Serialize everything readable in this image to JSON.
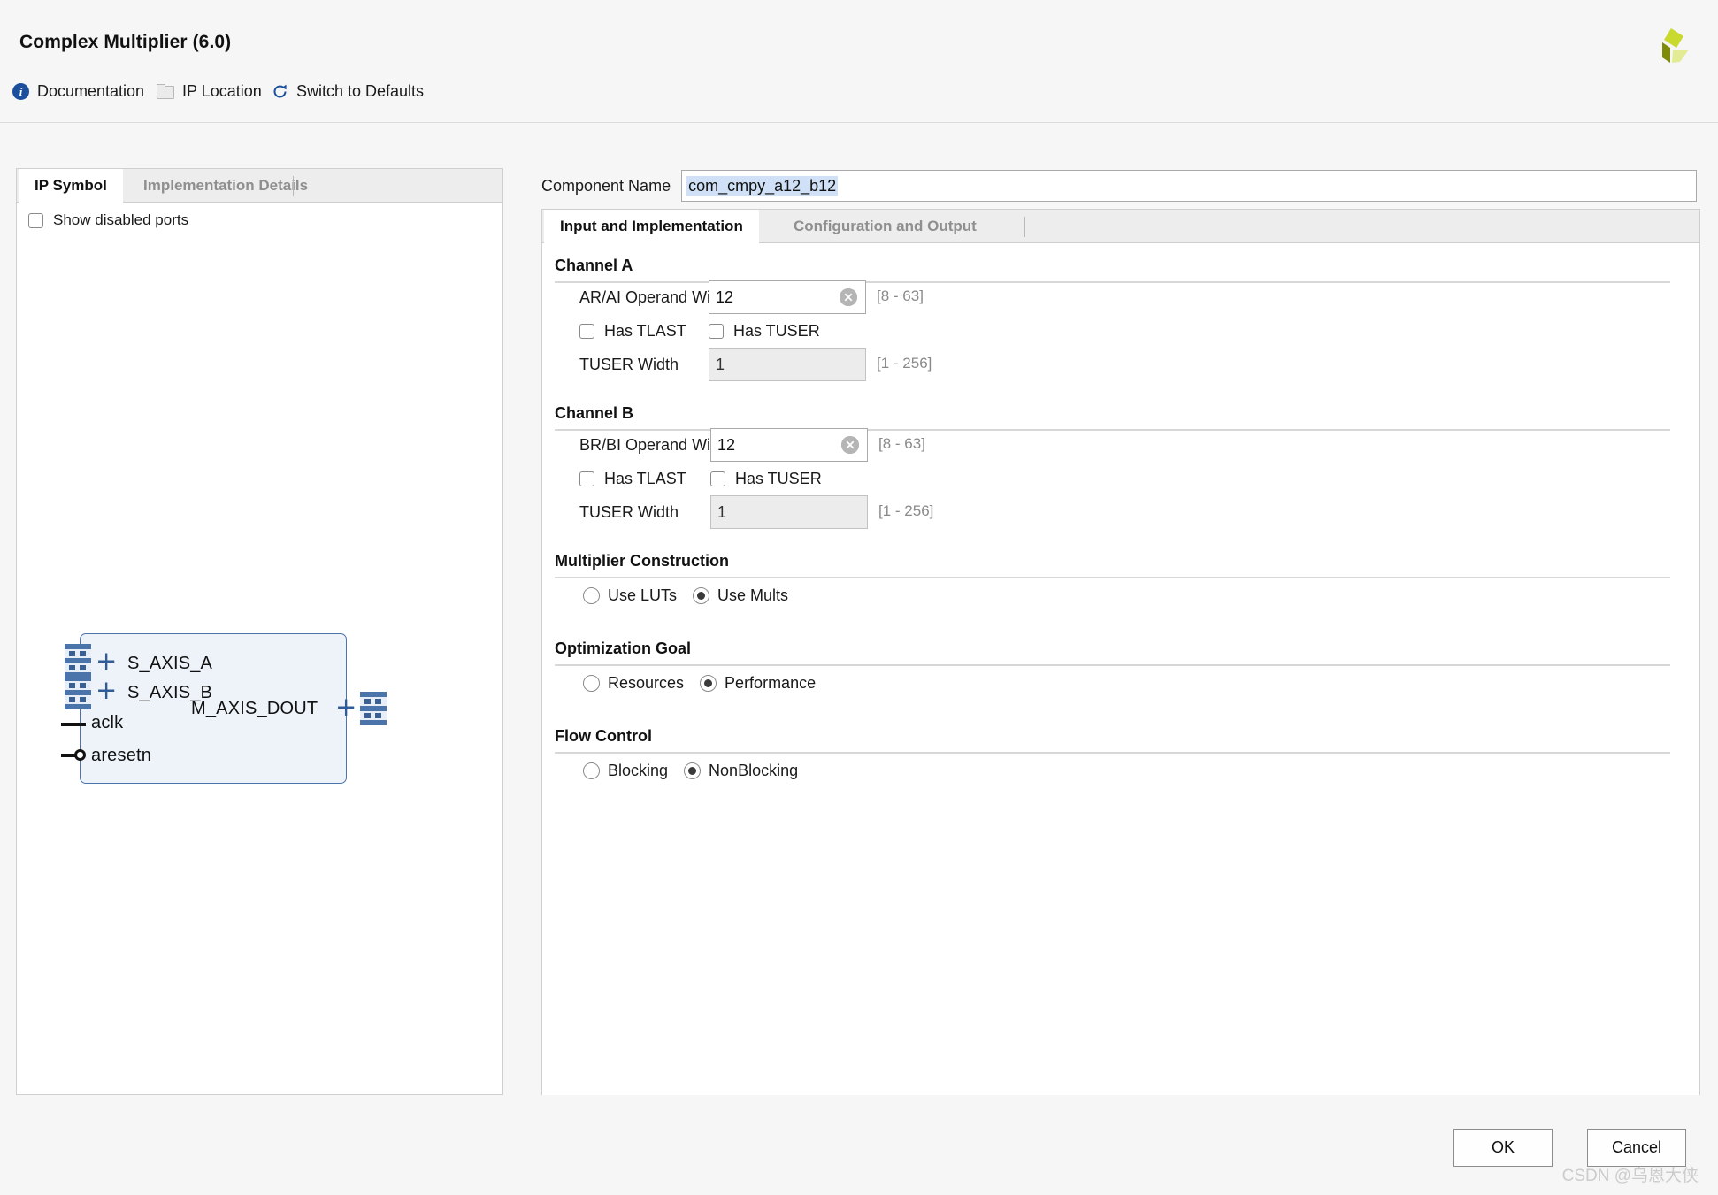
{
  "window": {
    "title": "Complex Multiplier (6.0)",
    "logo_colors": [
      "#c9d92e",
      "#7e8c09",
      "#e3ec95"
    ]
  },
  "toolbar": {
    "documentation": "Documentation",
    "ip_location": "IP Location",
    "switch_defaults": "Switch to Defaults",
    "icons": {
      "documentation": "info-icon",
      "ip_location": "folder-icon",
      "switch_defaults": "refresh-icon"
    }
  },
  "left_panel": {
    "tabs": [
      {
        "label": "IP Symbol",
        "active": true
      },
      {
        "label": "Implementation Details",
        "active": false
      }
    ],
    "show_disabled_ports": {
      "label": "Show disabled ports",
      "checked": false
    },
    "symbol": {
      "ports": [
        {
          "name": "S_AXIS_A",
          "kind": "bus",
          "side": "left"
        },
        {
          "name": "S_AXIS_B",
          "kind": "bus",
          "side": "left"
        },
        {
          "name": "M_AXIS_DOUT",
          "kind": "bus",
          "side": "right"
        },
        {
          "name": "aclk",
          "kind": "pin",
          "side": "left"
        },
        {
          "name": "aresetn",
          "kind": "pin-inverted",
          "side": "left"
        }
      ]
    }
  },
  "component_name": {
    "label": "Component Name",
    "value": "com_cmpy_a12_b12"
  },
  "right_panel": {
    "tabs": [
      {
        "label": "Input and Implementation",
        "active": true
      },
      {
        "label": "Configuration and Output",
        "active": false
      }
    ],
    "sections": {
      "channel_a": {
        "title": "Channel A",
        "operand_width": {
          "label": "AR/AI Operand Width",
          "value": "12",
          "range": "[8 - 63]"
        },
        "has_tlast": {
          "label": "Has TLAST",
          "checked": false
        },
        "has_tuser": {
          "label": "Has TUSER",
          "checked": false
        },
        "tuser_width": {
          "label": "TUSER Width",
          "value": "1",
          "range": "[1 - 256]",
          "disabled": true
        }
      },
      "channel_b": {
        "title": "Channel B",
        "operand_width": {
          "label": "BR/BI Operand Width",
          "value": "12",
          "range": "[8 - 63]"
        },
        "has_tlast": {
          "label": "Has TLAST",
          "checked": false
        },
        "has_tuser": {
          "label": "Has TUSER",
          "checked": false
        },
        "tuser_width": {
          "label": "TUSER Width",
          "value": "1",
          "range": "[1 - 256]",
          "disabled": true
        }
      },
      "multiplier_construction": {
        "title": "Multiplier Construction",
        "options": [
          {
            "label": "Use LUTs",
            "selected": false
          },
          {
            "label": "Use Mults",
            "selected": true
          }
        ]
      },
      "optimization_goal": {
        "title": "Optimization Goal",
        "options": [
          {
            "label": "Resources",
            "selected": false
          },
          {
            "label": "Performance",
            "selected": true
          }
        ]
      },
      "flow_control": {
        "title": "Flow Control",
        "options": [
          {
            "label": "Blocking",
            "selected": false
          },
          {
            "label": "NonBlocking",
            "selected": true
          }
        ]
      }
    }
  },
  "footer": {
    "ok": "OK",
    "cancel": "Cancel"
  },
  "watermark": "CSDN @乌恩大侠"
}
